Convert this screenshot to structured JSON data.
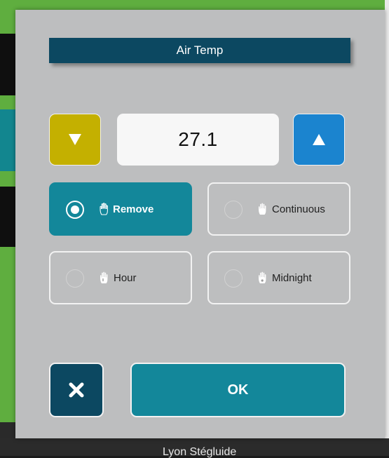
{
  "dialog": {
    "title": "Air Temp",
    "value": "27.1",
    "options": [
      {
        "label": "Remove",
        "selected": true
      },
      {
        "label": "Continuous",
        "selected": false
      },
      {
        "label": "Hour",
        "selected": false
      },
      {
        "label": "Midnight",
        "selected": false
      }
    ],
    "ok_label": "OK",
    "icons": {
      "decrease": "triangle-down-icon",
      "increase": "triangle-up-icon",
      "option": "hand-icon",
      "cancel": "close-icon"
    }
  },
  "background": {
    "partial_text": "Lyon Stégluide"
  },
  "colors": {
    "dialog_bg": "#bdbebf",
    "title_bg": "#0c4861",
    "decrease_btn": "#c4b000",
    "increase_btn": "#1b84cf",
    "selected_option": "#13879a",
    "ok_btn": "#13879a",
    "cancel_btn": "#0c4861"
  }
}
